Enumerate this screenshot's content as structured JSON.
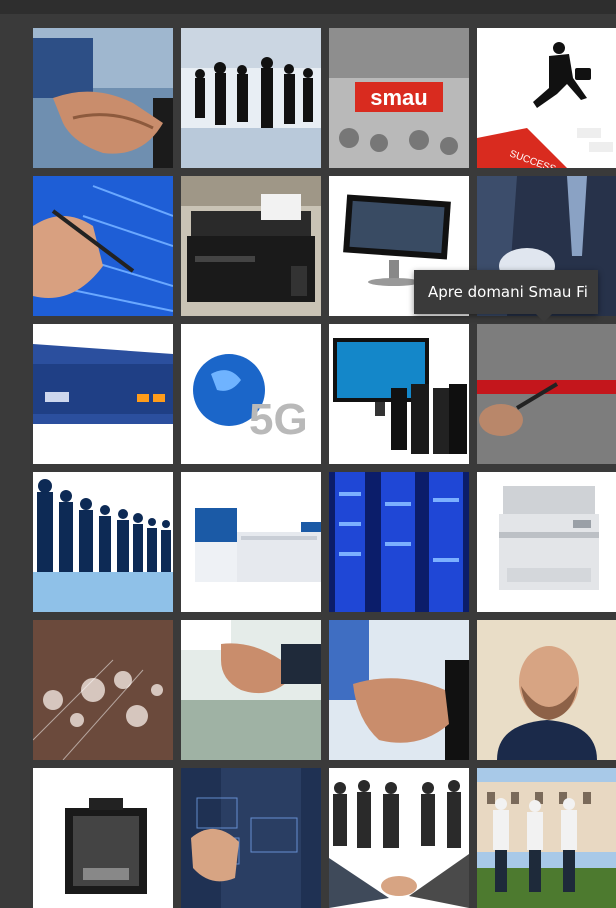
{
  "tooltip": {
    "text": "Apre domani Smau Fi"
  },
  "tiles": [
    {
      "name": "handshake-tile"
    },
    {
      "name": "business-team-silhouettes-tile"
    },
    {
      "name": "smau-event-tile",
      "logo_text": "smau"
    },
    {
      "name": "success-runner-tile",
      "sign_text": "SUCCESS"
    },
    {
      "name": "pen-binary-data-tile"
    },
    {
      "name": "printer-tile"
    },
    {
      "name": "monitor-tile"
    },
    {
      "name": "business-touch-tile"
    },
    {
      "name": "network-device-tile"
    },
    {
      "name": "globe-5g-tile",
      "label": "5G"
    },
    {
      "name": "computer-towers-tile"
    },
    {
      "name": "ribbon-cutting-tile"
    },
    {
      "name": "crowd-silhouettes-tile"
    },
    {
      "name": "production-printer-tile"
    },
    {
      "name": "server-rack-tile"
    },
    {
      "name": "office-printer-tile"
    },
    {
      "name": "fiber-optics-tile"
    },
    {
      "name": "handshake-office-tile"
    },
    {
      "name": "handshake-closeup-tile"
    },
    {
      "name": "portrait-man-tile"
    },
    {
      "name": "3d-printer-tile"
    },
    {
      "name": "virtual-touchscreen-tile"
    },
    {
      "name": "business-group-handshake-tile"
    },
    {
      "name": "group-outdoor-villa-tile"
    }
  ],
  "colors": {
    "background": "#3a3a3a",
    "smau_red": "#d92b1f",
    "tooltip_bg": "#3a3a3a"
  }
}
